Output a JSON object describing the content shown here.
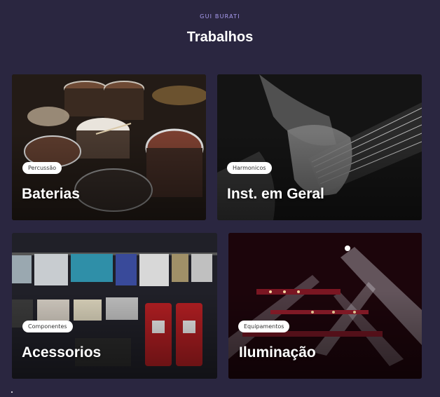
{
  "section": {
    "eyebrow": "GUI BURATI",
    "title": "Trabalhos"
  },
  "cards": [
    {
      "tag": "Percussão",
      "title": "Baterias",
      "image": "drum-kit-photo"
    },
    {
      "tag": "Harmonicos",
      "title": "Inst. em Geral",
      "image": "guitar-neck-photo"
    },
    {
      "tag": "Componentes",
      "title": "Acessorios",
      "image": "effects-pedals-photo"
    },
    {
      "tag": "Equipamentos",
      "title": "Iluminação",
      "image": "stage-lights-photo"
    }
  ]
}
